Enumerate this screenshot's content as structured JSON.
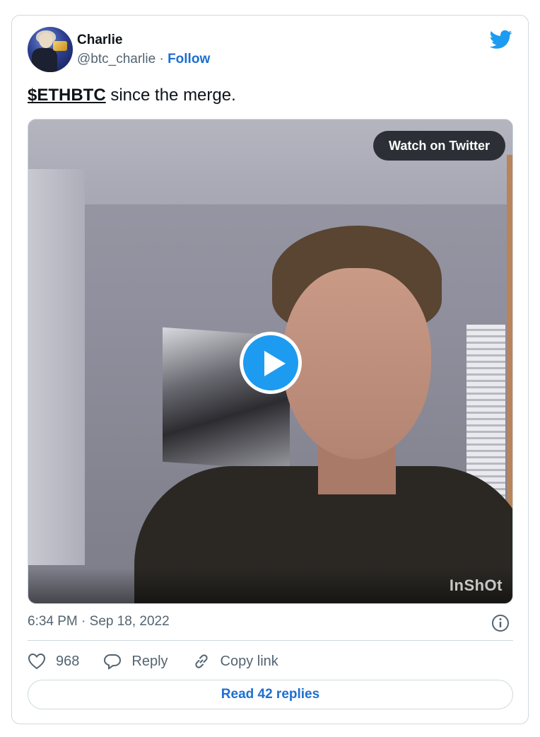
{
  "author": {
    "name": "Charlie",
    "handle": "@btc_charlie",
    "separator": "·",
    "follow_label": "Follow"
  },
  "tweet": {
    "cashtag": "$ETHBTC",
    "text_rest": " since the merge."
  },
  "video": {
    "watch_label": "Watch on Twitter",
    "watermark": "InShOt"
  },
  "meta": {
    "timestamp": "6:34 PM · Sep 18, 2022"
  },
  "actions": {
    "like_count": "968",
    "reply_label": "Reply",
    "copy_label": "Copy link"
  },
  "footer": {
    "read_replies_label": "Read 42 replies"
  },
  "colors": {
    "brand_blue": "#1d9bf0",
    "link_blue": "#1d6fd1",
    "muted": "#536471",
    "border": "#cfd9de"
  }
}
